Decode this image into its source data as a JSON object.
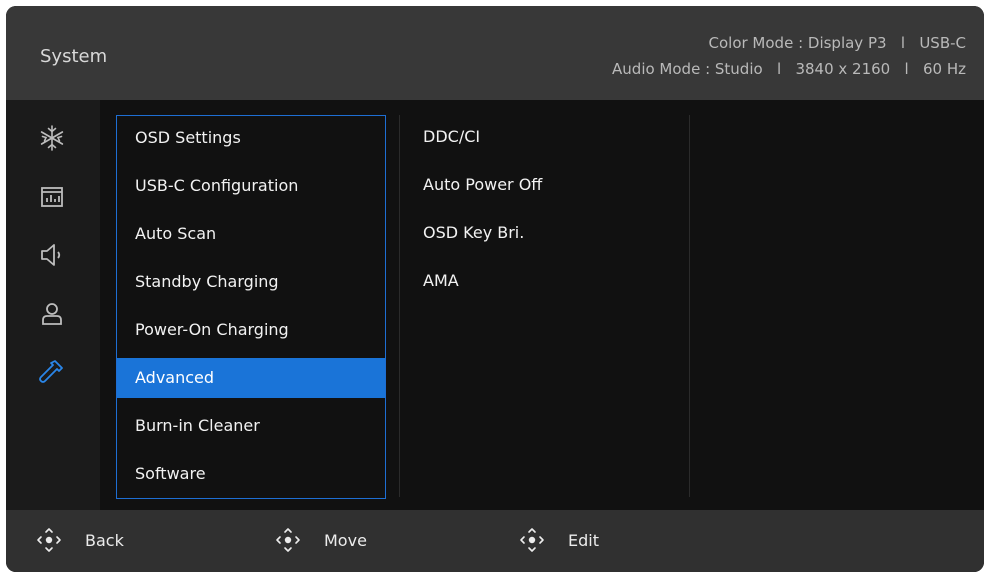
{
  "header": {
    "title": "System",
    "info_line1": "Color Mode : Display P3   l   USB-C",
    "info_line2": "Audio Mode : Studio   l   3840 x 2160   l   60 Hz"
  },
  "sidebar_icons": [
    "snowflake-icon",
    "chart-icon",
    "speaker-icon",
    "user-icon",
    "wrench-icon"
  ],
  "menu": {
    "items": [
      {
        "label": "OSD Settings"
      },
      {
        "label": "USB-C Configuration"
      },
      {
        "label": "Auto Scan"
      },
      {
        "label": "Standby Charging"
      },
      {
        "label": "Power-On Charging"
      },
      {
        "label": "Advanced"
      },
      {
        "label": "Burn-in Cleaner"
      },
      {
        "label": "Software"
      }
    ],
    "selected": "Advanced"
  },
  "submenu": {
    "items": [
      {
        "label": "DDC/CI"
      },
      {
        "label": "Auto Power Off"
      },
      {
        "label": "OSD Key Bri."
      },
      {
        "label": "AMA"
      }
    ]
  },
  "footer": {
    "back_label": "Back",
    "move_label": "Move",
    "edit_label": "Edit"
  },
  "colors": {
    "accent": "#1a74d8",
    "header_bg": "#383838",
    "footer_bg": "#303030"
  }
}
